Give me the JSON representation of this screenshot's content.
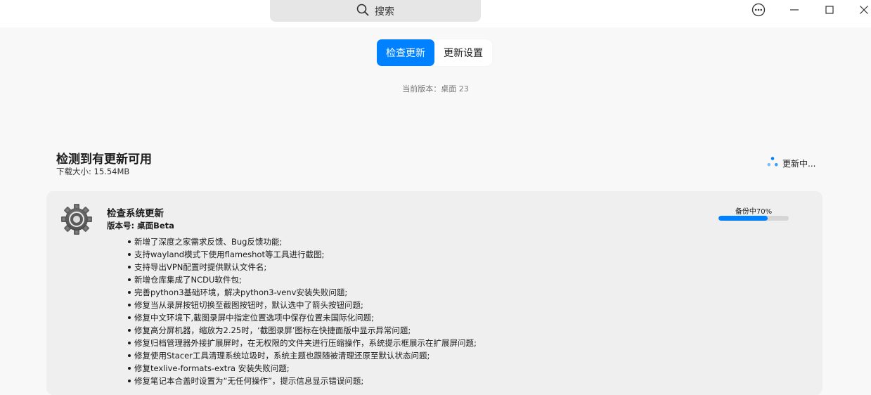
{
  "titlebar": {
    "search_label": "搜索"
  },
  "tabs": [
    {
      "label": "检查更新",
      "active": true
    },
    {
      "label": "更新设置",
      "active": false
    }
  ],
  "current_version": "当前版本：桌面 23",
  "update_section": {
    "title": "检测到有更新可用",
    "download_size": "下载大小: 15.54MB",
    "status": "更新中..."
  },
  "system_update": {
    "title": "检查系统更新",
    "version": "版本号: 桌面Beta",
    "backup_label": "备份中70%",
    "progress": 0.7,
    "changes": [
      "新增了深度之家需求反馈、Bug反馈功能;",
      "支持wayland模式下使用flameshot等工具进行截图;",
      "支持导出VPN配置时提供默认文件名;",
      "新增仓库集成了NCDU软件包;",
      "完善python3基础环境，解决python3-venv安装失败问题;",
      "修复当从录屏按钮切换至截图按钮时，默认选中了箭头按钮问题;",
      "修复中文环境下,截图录屏中指定位置选项中保存位置未国际化问题;",
      "修复高分屏机器，缩放为2.25时，‘截图录屏’图标在快捷面版中显示异常问题;",
      "修复归档管理器外接扩展屏时，在无权限的文件夹进行压缩操作，系统提示框展示在扩展屏问题;",
      "修复使用Stacer工具清理系统垃圾时，系统主题也跟随被清理还原至默认状态问题;",
      "修复texlive-formats-extra 安装失败问题;",
      "修复笔记本合盖时设置为“无任何操作”，提示信息显示错误问题;"
    ]
  },
  "colors": {
    "accent": "#0081ff",
    "card_bg": "#efefef",
    "page_bg": "#f8f8f8"
  }
}
